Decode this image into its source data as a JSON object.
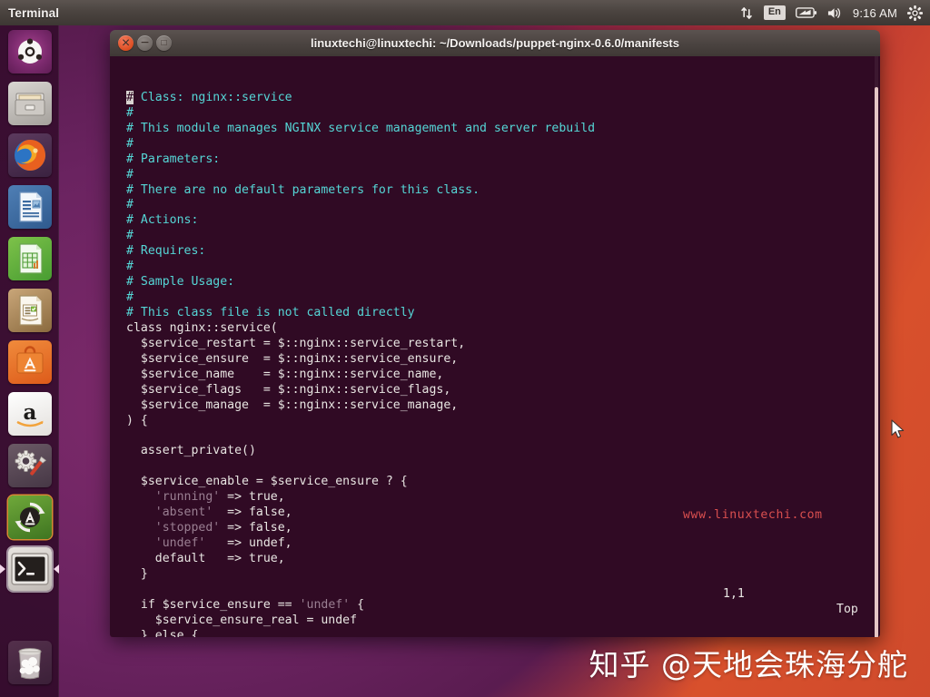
{
  "top_panel": {
    "app_title": "Terminal",
    "indicators": [
      {
        "name": "network-icon",
        "label": "network"
      },
      {
        "name": "keyboard-layout-indicator",
        "label": "En"
      },
      {
        "name": "battery-icon",
        "label": "battery"
      },
      {
        "name": "volume-icon",
        "label": "volume"
      }
    ],
    "clock": "9:16 AM",
    "session_menu": "gear-icon"
  },
  "launcher": {
    "items": [
      {
        "name": "dash-home",
        "label": "Ubuntu Dash Home",
        "active": false
      },
      {
        "name": "files",
        "label": "Files",
        "active": false
      },
      {
        "name": "firefox",
        "label": "Firefox Web Browser",
        "active": false
      },
      {
        "name": "libreoffice-writer",
        "label": "LibreOffice Writer",
        "active": false
      },
      {
        "name": "libreoffice-calc",
        "label": "LibreOffice Calc",
        "active": false
      },
      {
        "name": "libreoffice-impress",
        "label": "LibreOffice Impress",
        "active": false
      },
      {
        "name": "ubuntu-software",
        "label": "Ubuntu Software Center",
        "active": false
      },
      {
        "name": "amazon",
        "label": "Amazon",
        "active": false
      },
      {
        "name": "system-settings",
        "label": "System Settings",
        "active": false
      },
      {
        "name": "software-updater",
        "label": "Software Updater",
        "active": false
      },
      {
        "name": "terminal",
        "label": "Terminal",
        "active": true
      }
    ],
    "trash": {
      "name": "trash",
      "label": "Trash"
    }
  },
  "window": {
    "title": "linuxtechi@linuxtechi: ~/Downloads/puppet-nginx-0.6.0/manifests",
    "buttons": {
      "close": "×",
      "minimize": "−",
      "maximize": "□"
    }
  },
  "terminal": {
    "cursor_char": "#",
    "lines": [
      [
        {
          "t": "#",
          "c": "cursor-cell"
        },
        {
          "t": " Class: nginx::service",
          "c": "cmt"
        }
      ],
      [
        {
          "t": "#",
          "c": "cmt"
        }
      ],
      [
        {
          "t": "# This module manages NGINX service management and server rebuild",
          "c": "cmt"
        }
      ],
      [
        {
          "t": "#",
          "c": "cmt"
        }
      ],
      [
        {
          "t": "# Parameters:",
          "c": "cmt"
        }
      ],
      [
        {
          "t": "#",
          "c": "cmt"
        }
      ],
      [
        {
          "t": "# There are no default parameters for this class.",
          "c": "cmt"
        }
      ],
      [
        {
          "t": "#",
          "c": "cmt"
        }
      ],
      [
        {
          "t": "# Actions:",
          "c": "cmt"
        }
      ],
      [
        {
          "t": "#",
          "c": "cmt"
        }
      ],
      [
        {
          "t": "# Requires:",
          "c": "cmt"
        }
      ],
      [
        {
          "t": "#",
          "c": "cmt"
        }
      ],
      [
        {
          "t": "# Sample Usage:",
          "c": "cmt"
        }
      ],
      [
        {
          "t": "#",
          "c": "cmt"
        }
      ],
      [
        {
          "t": "# This class file is not called directly",
          "c": "cmt"
        }
      ],
      [
        {
          "t": "class nginx::service(",
          "c": ""
        }
      ],
      [
        {
          "t": "  $service_restart = $::nginx::service_restart,",
          "c": ""
        }
      ],
      [
        {
          "t": "  $service_ensure  = $::nginx::service_ensure,",
          "c": ""
        }
      ],
      [
        {
          "t": "  $service_name    = $::nginx::service_name,",
          "c": ""
        }
      ],
      [
        {
          "t": "  $service_flags   = $::nginx::service_flags,",
          "c": ""
        }
      ],
      [
        {
          "t": "  $service_manage  = $::nginx::service_manage,",
          "c": ""
        }
      ],
      [
        {
          "t": ") {",
          "c": ""
        }
      ],
      [
        {
          "t": "",
          "c": ""
        }
      ],
      [
        {
          "t": "  assert_private()",
          "c": ""
        }
      ],
      [
        {
          "t": "",
          "c": ""
        }
      ],
      [
        {
          "t": "  $service_enable = $service_ensure ? {",
          "c": ""
        }
      ],
      [
        {
          "t": "    ",
          "c": ""
        },
        {
          "t": "'running'",
          "c": "str"
        },
        {
          "t": " => true,",
          "c": ""
        }
      ],
      [
        {
          "t": "    ",
          "c": ""
        },
        {
          "t": "'absent'",
          "c": "str"
        },
        {
          "t": "  => false,",
          "c": ""
        }
      ],
      [
        {
          "t": "    ",
          "c": ""
        },
        {
          "t": "'stopped'",
          "c": "str"
        },
        {
          "t": " => false,",
          "c": ""
        }
      ],
      [
        {
          "t": "    ",
          "c": ""
        },
        {
          "t": "'undef'",
          "c": "str"
        },
        {
          "t": "   => undef,",
          "c": ""
        }
      ],
      [
        {
          "t": "    default   => true,",
          "c": ""
        }
      ],
      [
        {
          "t": "  }",
          "c": ""
        }
      ],
      [
        {
          "t": "",
          "c": ""
        }
      ],
      [
        {
          "t": "  if $service_ensure == ",
          "c": ""
        },
        {
          "t": "'undef'",
          "c": "str"
        },
        {
          "t": " {",
          "c": ""
        }
      ],
      [
        {
          "t": "    $service_ensure_real = undef",
          "c": ""
        }
      ],
      [
        {
          "t": "  } else {",
          "c": ""
        }
      ]
    ],
    "status": {
      "position": "1,1",
      "scroll": "Top"
    },
    "watermark_url": "www.linuxtechi.com"
  },
  "desktop": {
    "watermark": "知乎 @天地会珠海分舵"
  },
  "colors": {
    "terminal_bg": "#300a24",
    "comment": "#55d6d6",
    "string": "#9a7f92",
    "watermark_red": "#d94f4f",
    "panel_bg": "#3d3733"
  }
}
